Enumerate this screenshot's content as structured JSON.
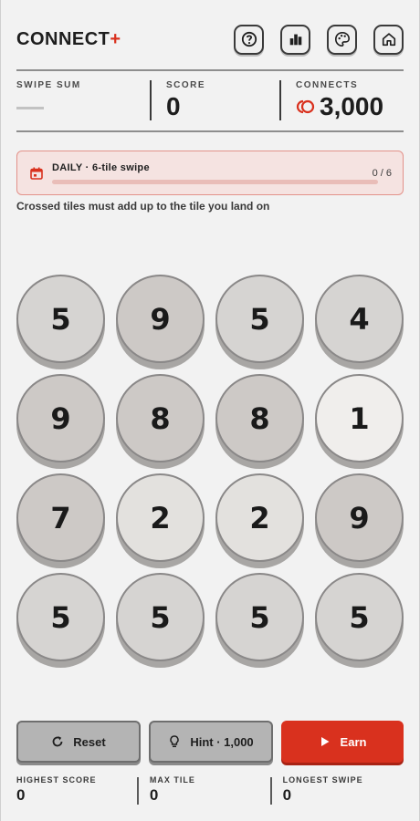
{
  "brand": {
    "name": "CONNECT",
    "plus": "+",
    "accent": "#d9311e"
  },
  "header_icons": [
    "help-icon",
    "stats-icon",
    "palette-icon",
    "home-icon"
  ],
  "stats": {
    "swipe_sum_label": "SWIPE SUM",
    "score_label": "SCORE",
    "score_value": "0",
    "connects_label": "CONNECTS",
    "connects_value": "3,000"
  },
  "daily": {
    "title": "DAILY · 6-tile swipe",
    "progress_current": 0,
    "progress_total": 6,
    "count_text": "0 / 6"
  },
  "rule_text": "Crossed tiles must add up to the tile you land on",
  "board": {
    "rows": [
      [
        {
          "v": "5",
          "shade": "mid"
        },
        {
          "v": "9",
          "shade": "dark"
        },
        {
          "v": "5",
          "shade": "mid"
        },
        {
          "v": "4",
          "shade": "mid"
        }
      ],
      [
        {
          "v": "9",
          "shade": "dark"
        },
        {
          "v": "8",
          "shade": "dark"
        },
        {
          "v": "8",
          "shade": "dark"
        },
        {
          "v": "1",
          "shade": "white"
        }
      ],
      [
        {
          "v": "7",
          "shade": "dark"
        },
        {
          "v": "2",
          "shade": "light"
        },
        {
          "v": "2",
          "shade": "light"
        },
        {
          "v": "9",
          "shade": "dark"
        }
      ],
      [
        {
          "v": "5",
          "shade": "mid"
        },
        {
          "v": "5",
          "shade": "mid"
        },
        {
          "v": "5",
          "shade": "mid"
        },
        {
          "v": "5",
          "shade": "mid"
        }
      ]
    ]
  },
  "actions": {
    "reset_label": "Reset",
    "hint_label": "Hint · 1,000",
    "earn_label": "Earn"
  },
  "footer": {
    "highest_score_label": "HIGHEST SCORE",
    "highest_score_value": "0",
    "max_tile_label": "MAX TILE",
    "max_tile_value": "0",
    "longest_swipe_label": "LONGEST SWIPE",
    "longest_swipe_value": "0"
  }
}
